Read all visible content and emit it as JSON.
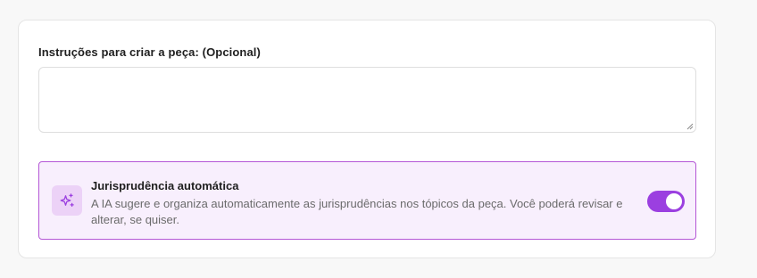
{
  "instructions": {
    "label": "Instruções para criar a peça: (Opcional)",
    "value": "",
    "placeholder": ""
  },
  "jurisprudence": {
    "title": "Jurisprudência automática",
    "description": "A IA sugere e organiza automaticamente as jurisprudências nos tópicos da peça. Você poderá revisar e alterar, se quiser.",
    "icon": "sparkles-icon",
    "toggle_enabled": true
  },
  "colors": {
    "accent": "#9b3fe0",
    "feature_border": "#b456d6",
    "feature_background": "#f8effd",
    "icon_background": "#ecd2f7"
  }
}
